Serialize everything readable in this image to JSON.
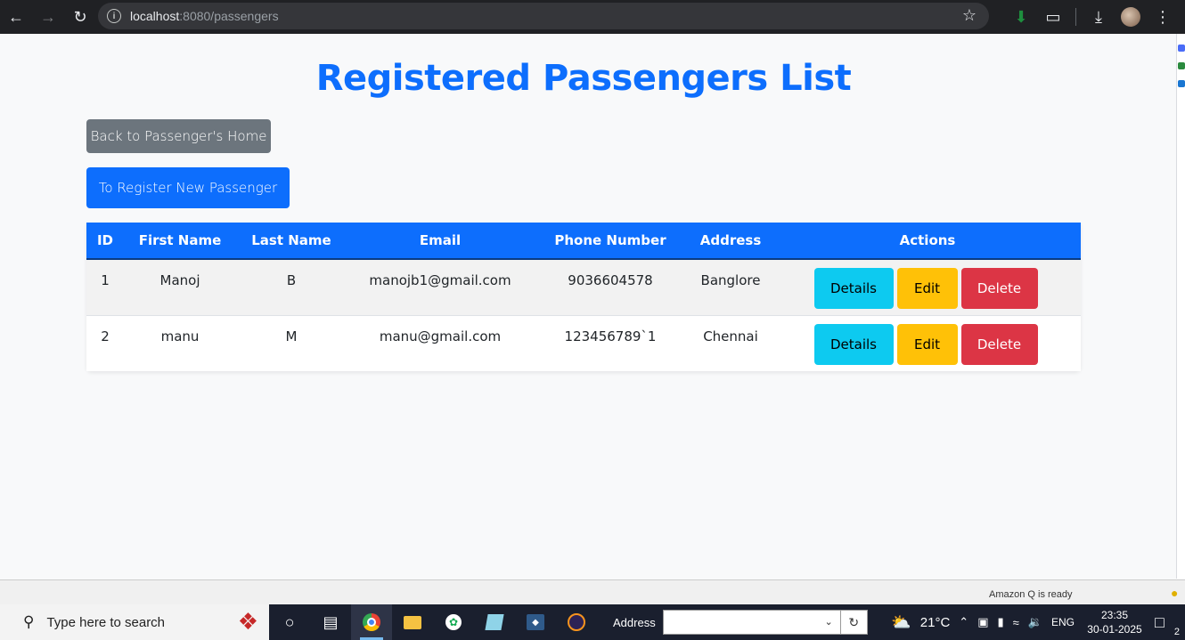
{
  "browser": {
    "url_host": "localhost",
    "url_path": ":8080/passengers"
  },
  "page": {
    "title": "Registered Passengers List",
    "back_button": "Back to Passenger's Home",
    "register_button": "To Register New Passenger"
  },
  "table": {
    "headers": [
      "ID",
      "First Name",
      "Last Name",
      "Email",
      "Phone Number",
      "Address",
      "Actions"
    ],
    "rows": [
      {
        "id": "1",
        "first_name": "Manoj",
        "last_name": "B",
        "email": "manojb1@gmail.com",
        "phone": "9036604578",
        "address": "Banglore"
      },
      {
        "id": "2",
        "first_name": "manu",
        "last_name": "M",
        "email": "manu@gmail.com",
        "phone": "123456789`1",
        "address": "Chennai"
      }
    ],
    "actions": {
      "details": "Details",
      "edit": "Edit",
      "delete": "Delete"
    }
  },
  "status_strip": {
    "text": "Amazon Q is ready"
  },
  "taskbar": {
    "search_placeholder": "Type here to search",
    "address_label": "Address",
    "temperature": "21°C",
    "language": "ENG",
    "time": "23:35",
    "date": "30-01-2025",
    "notification_count": "2"
  },
  "colors": {
    "primary": "#0d6efd",
    "secondary": "#6c757d",
    "info": "#0dcaf0",
    "warning": "#ffc107",
    "danger": "#dc3545"
  }
}
